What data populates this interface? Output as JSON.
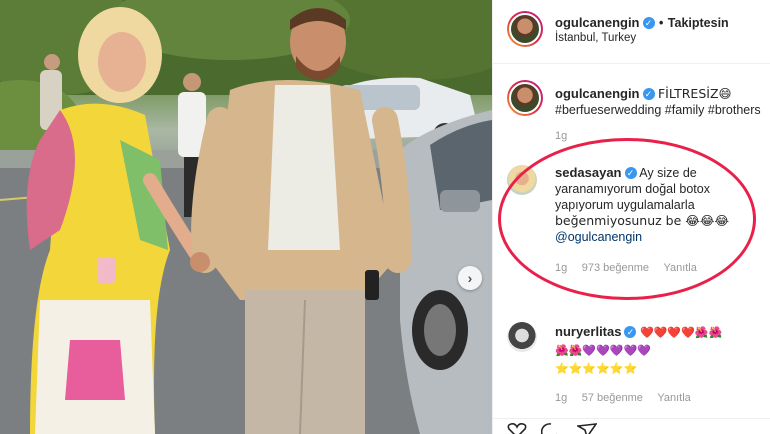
{
  "post_header": {
    "username": "ogulcanengin",
    "separator": "•",
    "follow_status": "Takiptesin",
    "location": "İstanbul, Turkey"
  },
  "caption": {
    "username": "ogulcanengin",
    "text": "FİLTRESİZ😄",
    "hashtags": "#berfueserwedding #family #brothers",
    "time": "1g"
  },
  "comments": [
    {
      "username": "sedasayan",
      "text_line1": "Ay size de",
      "text_line2": "yaranamıyorum doğal botox",
      "text_line3": "yapıyorum uygulamalarla",
      "text_line4": "beğenmiyosunuz be 😂😂😂",
      "mention": "@ogulcanengin",
      "time": "1g",
      "likes": "973 beğenme",
      "reply": "Yanıtla"
    },
    {
      "username": "nuryerlitas",
      "emoji_line1": "❤️❤️❤️❤️🌺🌺",
      "emoji_line2": "🌺🌺💜💜💜💜💜",
      "emoji_line3": "⭐⭐⭐⭐⭐⭐",
      "time": "1g",
      "likes": "57 beğenme",
      "reply": "Yanıtla"
    }
  ],
  "icons": {
    "carousel_next": "chevron-right-icon",
    "verified": "verified-badge-icon"
  },
  "colors": {
    "link": "#003569",
    "verified": "#3897f0",
    "highlight": "#e8204a",
    "muted": "#999999"
  }
}
